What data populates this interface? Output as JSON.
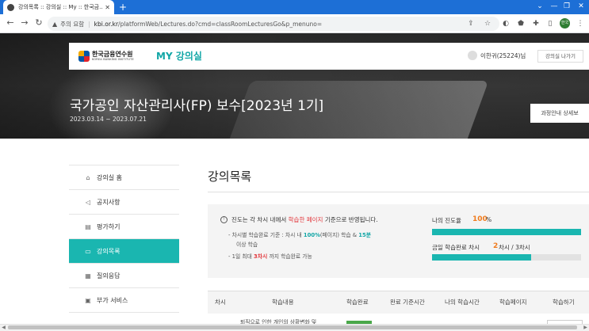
{
  "browser": {
    "tab_title": "강의목록 :: 강의실 :: My :: 한국금...",
    "tab_close": "✕",
    "new_tab": "+",
    "window_controls": [
      "⌄",
      "—",
      "❐",
      "✕"
    ],
    "nav": {
      "back": "←",
      "forward": "→",
      "reload": "↻"
    },
    "security_label": "주의 요함",
    "host": "kbi.or.kr",
    "path": "/platformWeb/Lectures.do?cmd=classRoomLecturesGo&p_menuno=",
    "profile_label": "한국"
  },
  "header": {
    "logo_ko": "한국금융연수원",
    "logo_en": "KOREA BANKING INSTITUTE",
    "my_title": "MY 강의실",
    "user_name": "이한귀(25224)님",
    "exit_button": "강의실 나가기"
  },
  "hero": {
    "course_title": "국가공인 자산관리사(FP) 보수[2023년 1기]",
    "course_dates": "2023.03.14 ~ 2023.07.21",
    "guide_button": "과정안내 상세보"
  },
  "sidebar": {
    "items": [
      {
        "label": "강의실 홈",
        "icon": "home-icon",
        "glyph": "⌂"
      },
      {
        "label": "공지사항",
        "icon": "megaphone-icon",
        "glyph": "◁"
      },
      {
        "label": "평가하기",
        "icon": "document-icon",
        "glyph": "▤"
      },
      {
        "label": "강의목록",
        "icon": "monitor-icon",
        "glyph": "▭"
      },
      {
        "label": "질의응답",
        "icon": "qa-icon",
        "glyph": "▦"
      },
      {
        "label": "부가 서비스",
        "icon": "service-icon",
        "glyph": "▣"
      }
    ],
    "active_index": 3
  },
  "main": {
    "title": "강의목록",
    "notice": {
      "before": "진도는 각 차시 내에서 ",
      "highlight": "학습한 페이지",
      "after": " 기준으로 반영됩니다."
    },
    "bullets": {
      "b1_pre": "- 차시별 학습완료 기준 : 차시 내 ",
      "b1_pct": "100%",
      "b1_mid": "(페이지) 학습 & ",
      "b1_min": "15분",
      "b1_cont": "이상 학습",
      "b2_pre": "- 1일 최대 ",
      "b2_val": "3차시",
      "b2_post": " 까지 학습완료 가능"
    },
    "my_progress": {
      "label": "나의 진도율",
      "value": "100",
      "unit": "%",
      "fraction": 1.0
    },
    "today": {
      "label": "금일 학습완료 차시",
      "value": "2",
      "unit": "차시 / 3차시",
      "fraction": 0.6667
    },
    "table": {
      "headers": [
        "차시",
        "학습내용",
        "학습완료",
        "완료 기준시간",
        "나의 학습시간",
        "학습페이지",
        "학습하기"
      ],
      "row1_text": "퇴직으로 인한 개인의 상황변화 및"
    }
  },
  "colors": {
    "accent": "#1ab6b0",
    "brand_teal": "#12a6a6",
    "highlight_red": "#e2353a",
    "progress_orange": "#f07b1d",
    "chrome_blue": "#1d6fd6"
  }
}
